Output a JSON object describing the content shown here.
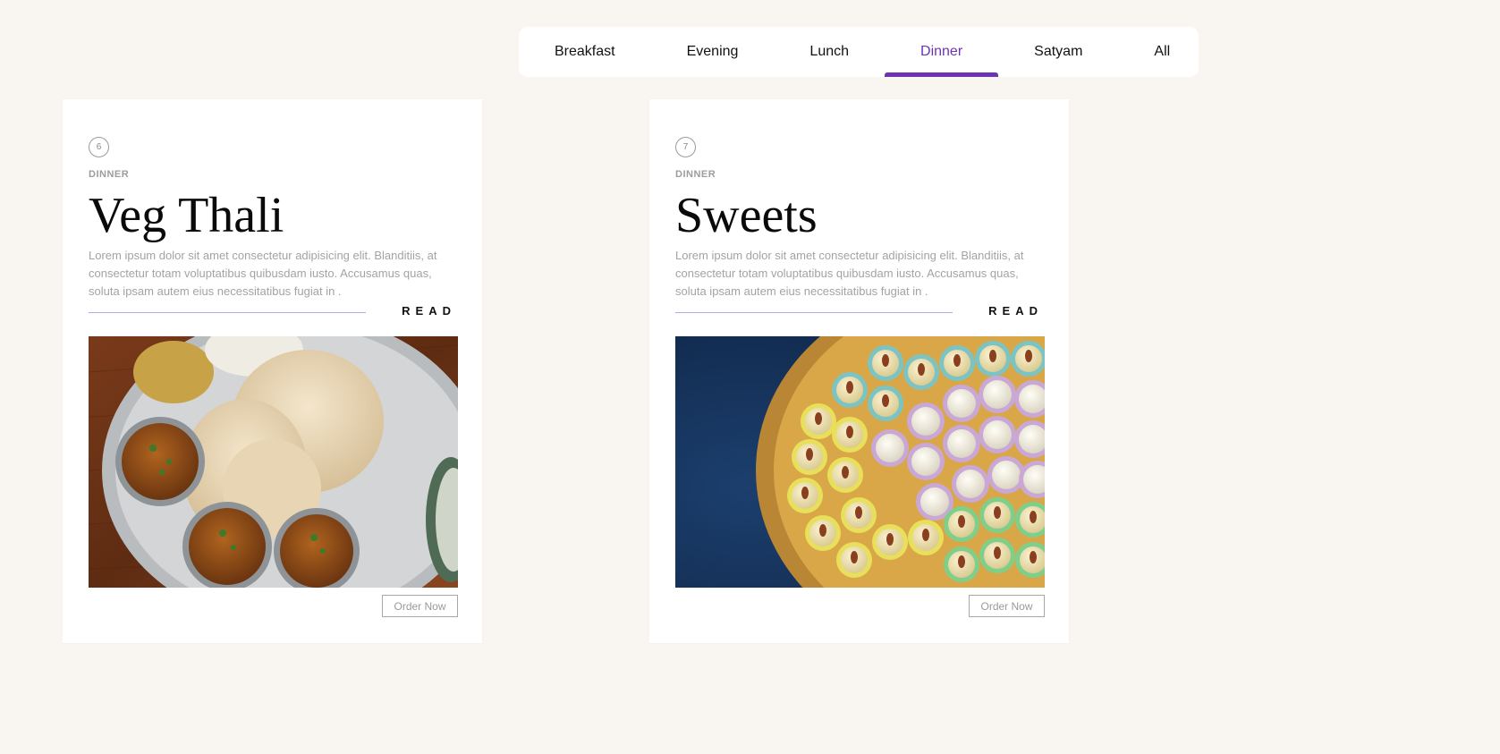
{
  "tabs": [
    {
      "label": "Breakfast"
    },
    {
      "label": "Evening"
    },
    {
      "label": "Lunch"
    },
    {
      "label": "Dinner",
      "active": true
    },
    {
      "label": "Satyam"
    },
    {
      "label": "All"
    }
  ],
  "accent_color": "#6b35b0",
  "cards": [
    {
      "number": "6",
      "category": "DINNER",
      "title": "Veg Thali",
      "description": "Lorem ipsum dolor sit amet consectetur adipisicing elit. Blanditiis, at consectetur totam voluptatibus quibusdam iusto. Accusamus quas, soluta ipsam autem eius necessitatibus fugiat in .",
      "read_label": "READ",
      "order_label": "Order Now"
    },
    {
      "number": "7",
      "category": "DINNER",
      "title": "Sweets",
      "description": "Lorem ipsum dolor sit amet consectetur adipisicing elit. Blanditiis, at consectetur totam voluptatibus quibusdam iusto. Accusamus quas, soluta ipsam autem eius necessitatibus fugiat in .",
      "read_label": "READ",
      "order_label": "Order Now"
    }
  ]
}
